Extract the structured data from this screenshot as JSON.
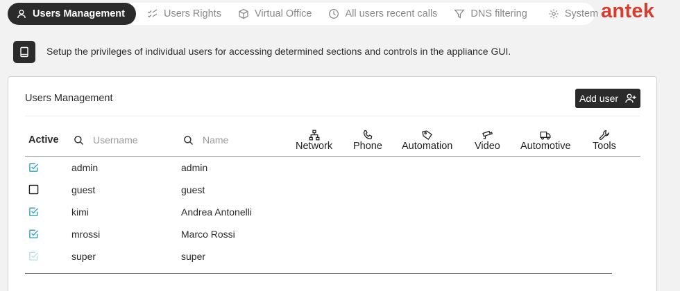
{
  "tabs": [
    {
      "label": "Users Management",
      "icon": "user-icon",
      "active": true
    },
    {
      "label": "Users Rights",
      "icon": "checklist-icon",
      "active": false
    },
    {
      "label": "Virtual Office",
      "icon": "cube-icon",
      "active": false
    },
    {
      "label": "All users recent calls",
      "icon": "clock-icon",
      "active": false
    },
    {
      "label": "DNS filtering",
      "icon": "filter-icon",
      "active": false
    },
    {
      "label": "System",
      "icon": "gear-icon",
      "active": false
    }
  ],
  "brand": {
    "logo_text": "antek",
    "color": "#d83c2e"
  },
  "info": {
    "text": "Setup the privileges of individual users for accessing determined sections and controls in the appliance GUI."
  },
  "card": {
    "title": "Users Management",
    "add_user_label": "Add user"
  },
  "table": {
    "active_header": "Active",
    "username_placeholder": "Username",
    "name_placeholder": "Name",
    "columns": [
      {
        "label": "Network",
        "icon": "network-icon"
      },
      {
        "label": "Phone",
        "icon": "phone-icon"
      },
      {
        "label": "Automation",
        "icon": "tag-icon"
      },
      {
        "label": "Video",
        "icon": "camera-icon"
      },
      {
        "label": "Automotive",
        "icon": "truck-icon"
      },
      {
        "label": "Tools",
        "icon": "wrench-icon"
      }
    ],
    "rows": [
      {
        "active": true,
        "username": "admin",
        "name": "admin"
      },
      {
        "active": false,
        "username": "guest",
        "name": "guest"
      },
      {
        "active": true,
        "username": "kimi",
        "name": "Andrea Antonelli"
      },
      {
        "active": true,
        "username": "mrossi",
        "name": "Marco Rossi"
      },
      {
        "active": true,
        "username": "super",
        "name": "super",
        "disabled": true
      }
    ]
  },
  "colors": {
    "accent": "#2ea3c7",
    "dark": "#2b2b2b"
  }
}
